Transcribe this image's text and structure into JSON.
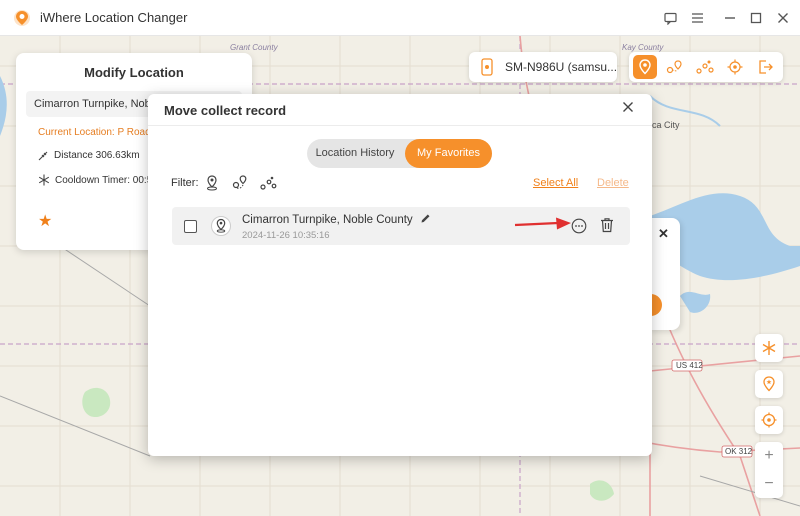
{
  "window": {
    "title": "iWhere Location Changer",
    "controls": [
      "feedback-icon",
      "menu-icon",
      "minimize-icon",
      "maximize-icon",
      "close-icon"
    ]
  },
  "map": {
    "labels": {
      "grant_county": "Grant County",
      "kay_county": "Kay County",
      "city_fragment": "ca City",
      "route_us412": "US 412",
      "route_ok312": "OK 312"
    }
  },
  "modify_panel": {
    "title": "Modify Location",
    "input_value": "Cimarron Turnpike,  Noble County",
    "current_location": "Current Location: P Road,",
    "distance": "Distance 306.63km",
    "cooldown": "Cooldown Timer: 00:5"
  },
  "device": {
    "name": "SM-N986U (samsu..."
  },
  "toolbar": {
    "tools": [
      "teleport-icon",
      "one-stop-icon",
      "multi-stop-icon",
      "joystick-icon",
      "exit-icon"
    ],
    "active_index": 0
  },
  "colors": {
    "accent": "#f6902b",
    "link": "#f0801a",
    "map_bg": "#f2efe6",
    "water": "#a9cde9"
  },
  "modal": {
    "title": "Move collect record",
    "tabs": {
      "history": "Location History",
      "favorites": "My Favorites",
      "selected": "My Favorites"
    },
    "filter_label": "Filter:",
    "select_all": "Select All",
    "delete": "Delete",
    "records": [
      {
        "name": "Cimarron Turnpike, Noble County",
        "time": "2024-11-26 10:35:16",
        "checked": false
      }
    ]
  }
}
